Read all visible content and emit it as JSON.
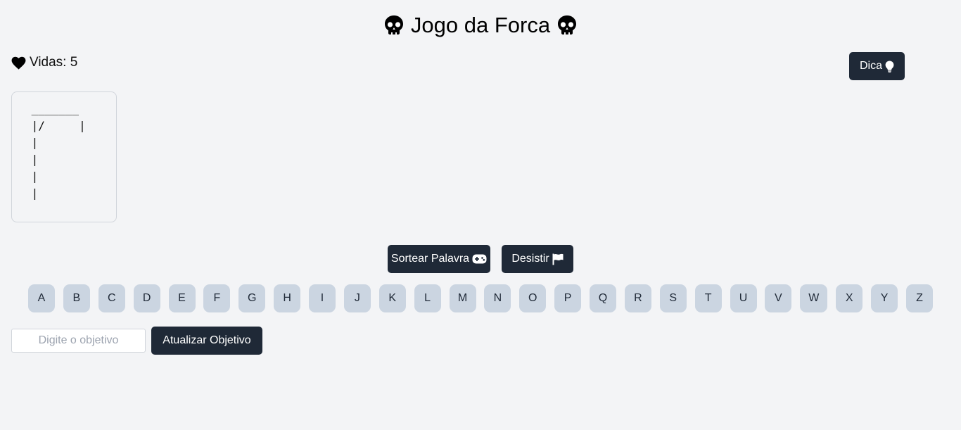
{
  "header": {
    "title": "Jogo da Forca",
    "icon": "skull-icon"
  },
  "lives": {
    "text": "Vidas: 5",
    "icon": "heart-icon"
  },
  "hint_button": {
    "label": "Dica",
    "icon": "lightbulb-icon"
  },
  "gallows": {
    "drawing": " _______\n |/     |\n |\n |\n |\n |"
  },
  "actions": {
    "draw_label": "Sortear Palavra",
    "draw_icon": "gamepad-icon",
    "give_up_label": "Desistir",
    "give_up_icon": "flag-icon"
  },
  "letters": [
    "A",
    "B",
    "C",
    "D",
    "E",
    "F",
    "G",
    "H",
    "I",
    "J",
    "K",
    "L",
    "M",
    "N",
    "O",
    "P",
    "Q",
    "R",
    "S",
    "T",
    "U",
    "V",
    "W",
    "X",
    "Y",
    "Z"
  ],
  "objective": {
    "placeholder": "Digite o objetivo",
    "value": "",
    "button_label": "Atualizar Objetivo"
  },
  "colors": {
    "background": "#f3f4f6",
    "button": "#1f2937",
    "letter_key": "#cbd5e1"
  }
}
